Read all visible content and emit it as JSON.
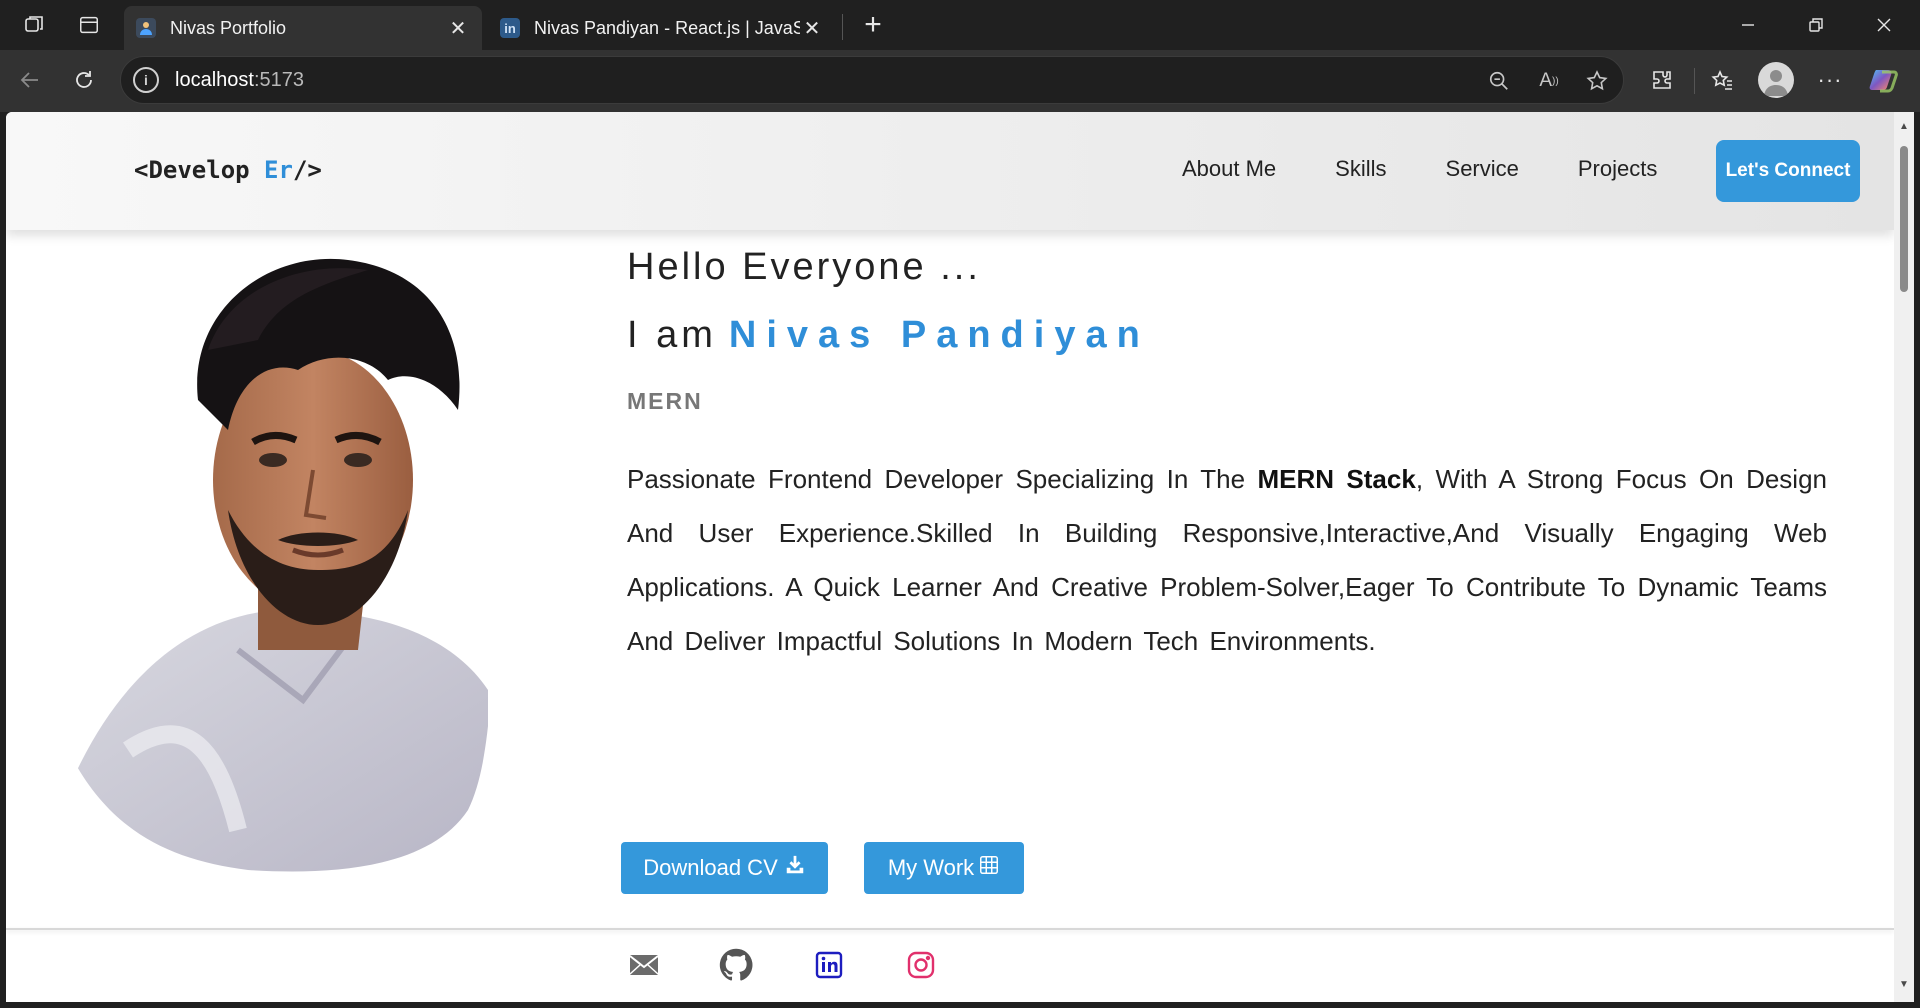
{
  "browser": {
    "tabs": [
      {
        "title": "Nivas Portfolio",
        "active": true
      },
      {
        "title": "Nivas Pandiyan - React.js | JavaScript",
        "active": false
      }
    ],
    "url_host": "localhost",
    "url_port": ":5173",
    "favicon_linkedin": "in"
  },
  "nav": {
    "logo_prefix": "<Develop ",
    "logo_accent": "Er",
    "logo_suffix": "/>",
    "links": [
      "About Me",
      "Skills",
      "Service",
      "Projects"
    ],
    "cta": "Let's Connect"
  },
  "hero": {
    "greeting": "Hello Everyone ...",
    "iam": "I am",
    "name": "Nivas Pandiyan",
    "role": "MERN",
    "bio_before": "Passionate Frontend Developer Specializing In The ",
    "bio_bold": "MERN Stack",
    "bio_after": ", With A Strong Focus On Design And User Experience.Skilled In Building Responsive,Interactive,And Visually Engaging Web Applications. A Quick Learner And Creative Problem-Solver,Eager To Contribute To Dynamic Teams And Deliver Impactful Solutions In Modern Tech Environments.",
    "download_cv": "Download CV",
    "my_work": "My Work",
    "socials": [
      "mail-icon",
      "github-icon",
      "linkedin-icon",
      "instagram-icon"
    ]
  },
  "colors": {
    "accent": "#3498db",
    "name": "#2f8ed8",
    "linkedin": "#1d1dbf",
    "instagram": "#e1306c"
  }
}
